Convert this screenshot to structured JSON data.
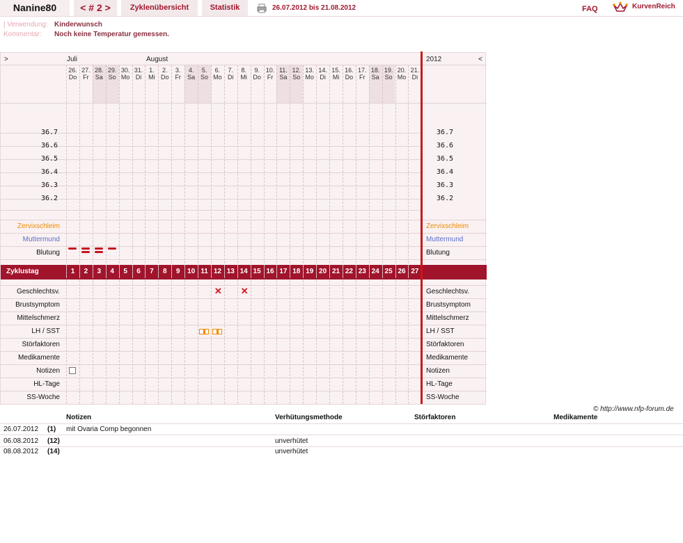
{
  "topbar": {
    "user": "Nanine80",
    "nav": "< # 2 >",
    "overview": "Zyklenübersicht",
    "stats": "Statistik",
    "dates": "26.07.2012 bis 21.08.2012",
    "faq": "FAQ",
    "logo": "KurvenReich"
  },
  "meta": {
    "usage_label": "| Verwendung:",
    "usage_value": "Kinderwunsch",
    "comment_label": "Kommentar:",
    "comment_value": "Noch keine Temperatur gemessen."
  },
  "chart": {
    "nav_left": ">",
    "nav_right": "<",
    "year": "2012",
    "months": [
      "Juli",
      "August"
    ],
    "days": [
      {
        "d": "26.",
        "w": "Do",
        "weekend": false
      },
      {
        "d": "27.",
        "w": "Fr",
        "weekend": false
      },
      {
        "d": "28.",
        "w": "Sa",
        "weekend": true
      },
      {
        "d": "29.",
        "w": "So",
        "weekend": true
      },
      {
        "d": "30.",
        "w": "Mo",
        "weekend": false
      },
      {
        "d": "31.",
        "w": "Di",
        "weekend": false
      },
      {
        "d": "1.",
        "w": "Mi",
        "weekend": false
      },
      {
        "d": "2.",
        "w": "Do",
        "weekend": false
      },
      {
        "d": "3.",
        "w": "Fr",
        "weekend": false
      },
      {
        "d": "4.",
        "w": "Sa",
        "weekend": true
      },
      {
        "d": "5.",
        "w": "So",
        "weekend": true
      },
      {
        "d": "6.",
        "w": "Mo",
        "weekend": false
      },
      {
        "d": "7.",
        "w": "Di",
        "weekend": false
      },
      {
        "d": "8.",
        "w": "Mi",
        "weekend": false
      },
      {
        "d": "9.",
        "w": "Do",
        "weekend": false
      },
      {
        "d": "10.",
        "w": "Fr",
        "weekend": false
      },
      {
        "d": "11.",
        "w": "Sa",
        "weekend": true
      },
      {
        "d": "12.",
        "w": "So",
        "weekend": true
      },
      {
        "d": "13.",
        "w": "Mo",
        "weekend": false
      },
      {
        "d": "14.",
        "w": "Di",
        "weekend": false
      },
      {
        "d": "15.",
        "w": "Mi",
        "weekend": false
      },
      {
        "d": "16.",
        "w": "Do",
        "weekend": false
      },
      {
        "d": "17.",
        "w": "Fr",
        "weekend": false
      },
      {
        "d": "18.",
        "w": "Sa",
        "weekend": true
      },
      {
        "d": "19.",
        "w": "So",
        "weekend": true
      },
      {
        "d": "20.",
        "w": "Mo",
        "weekend": false
      },
      {
        "d": "21.",
        "w": "Di",
        "weekend": false
      }
    ],
    "temps": [
      "36.7",
      "36.6",
      "36.5",
      "36.4",
      "36.3",
      "36.2"
    ],
    "upper_rows": [
      {
        "label": "Zervixschleim",
        "color": "#f08a00"
      },
      {
        "label": "Muttermund",
        "color": "#5b6fc9"
      },
      {
        "label": "Blutung",
        "color": "#111111"
      }
    ],
    "cycle_label": "Zyklustag",
    "cycle_days": [
      "1",
      "2",
      "3",
      "4",
      "5",
      "6",
      "7",
      "8",
      "9",
      "10",
      "11",
      "12",
      "13",
      "14",
      "15",
      "16",
      "17",
      "18",
      "19",
      "20",
      "21",
      "22",
      "23",
      "24",
      "25",
      "26",
      "27"
    ],
    "lower_rows": [
      "Geschlechtsv.",
      "Brustsymptom",
      "Mittelschmerz",
      "LH / SST",
      "Störfaktoren",
      "Medikamente",
      "Notizen",
      "HL-Tage",
      "SS-Woche"
    ],
    "bleeding_days": [
      1,
      2,
      3,
      4
    ],
    "intercourse_days": [
      12,
      14
    ],
    "lh_days": [
      11,
      12
    ],
    "note_days": [
      1
    ],
    "accent": "#a0142c",
    "divider": "#cc1717"
  },
  "copyright": "© http://www.nfp-forum.de",
  "notes_table": {
    "headers": [
      "Notizen",
      "Verhütungsmethode",
      "Störfaktoren",
      "Medikamente"
    ],
    "rows": [
      {
        "date": "26.07.2012",
        "day": "(1)",
        "note": "mit Ovaria Comp begonnen",
        "method": ""
      },
      {
        "date": "06.08.2012",
        "day": "(12)",
        "note": "",
        "method": "unverhütet"
      },
      {
        "date": "08.08.2012",
        "day": "(14)",
        "note": "",
        "method": "unverhütet"
      }
    ]
  }
}
